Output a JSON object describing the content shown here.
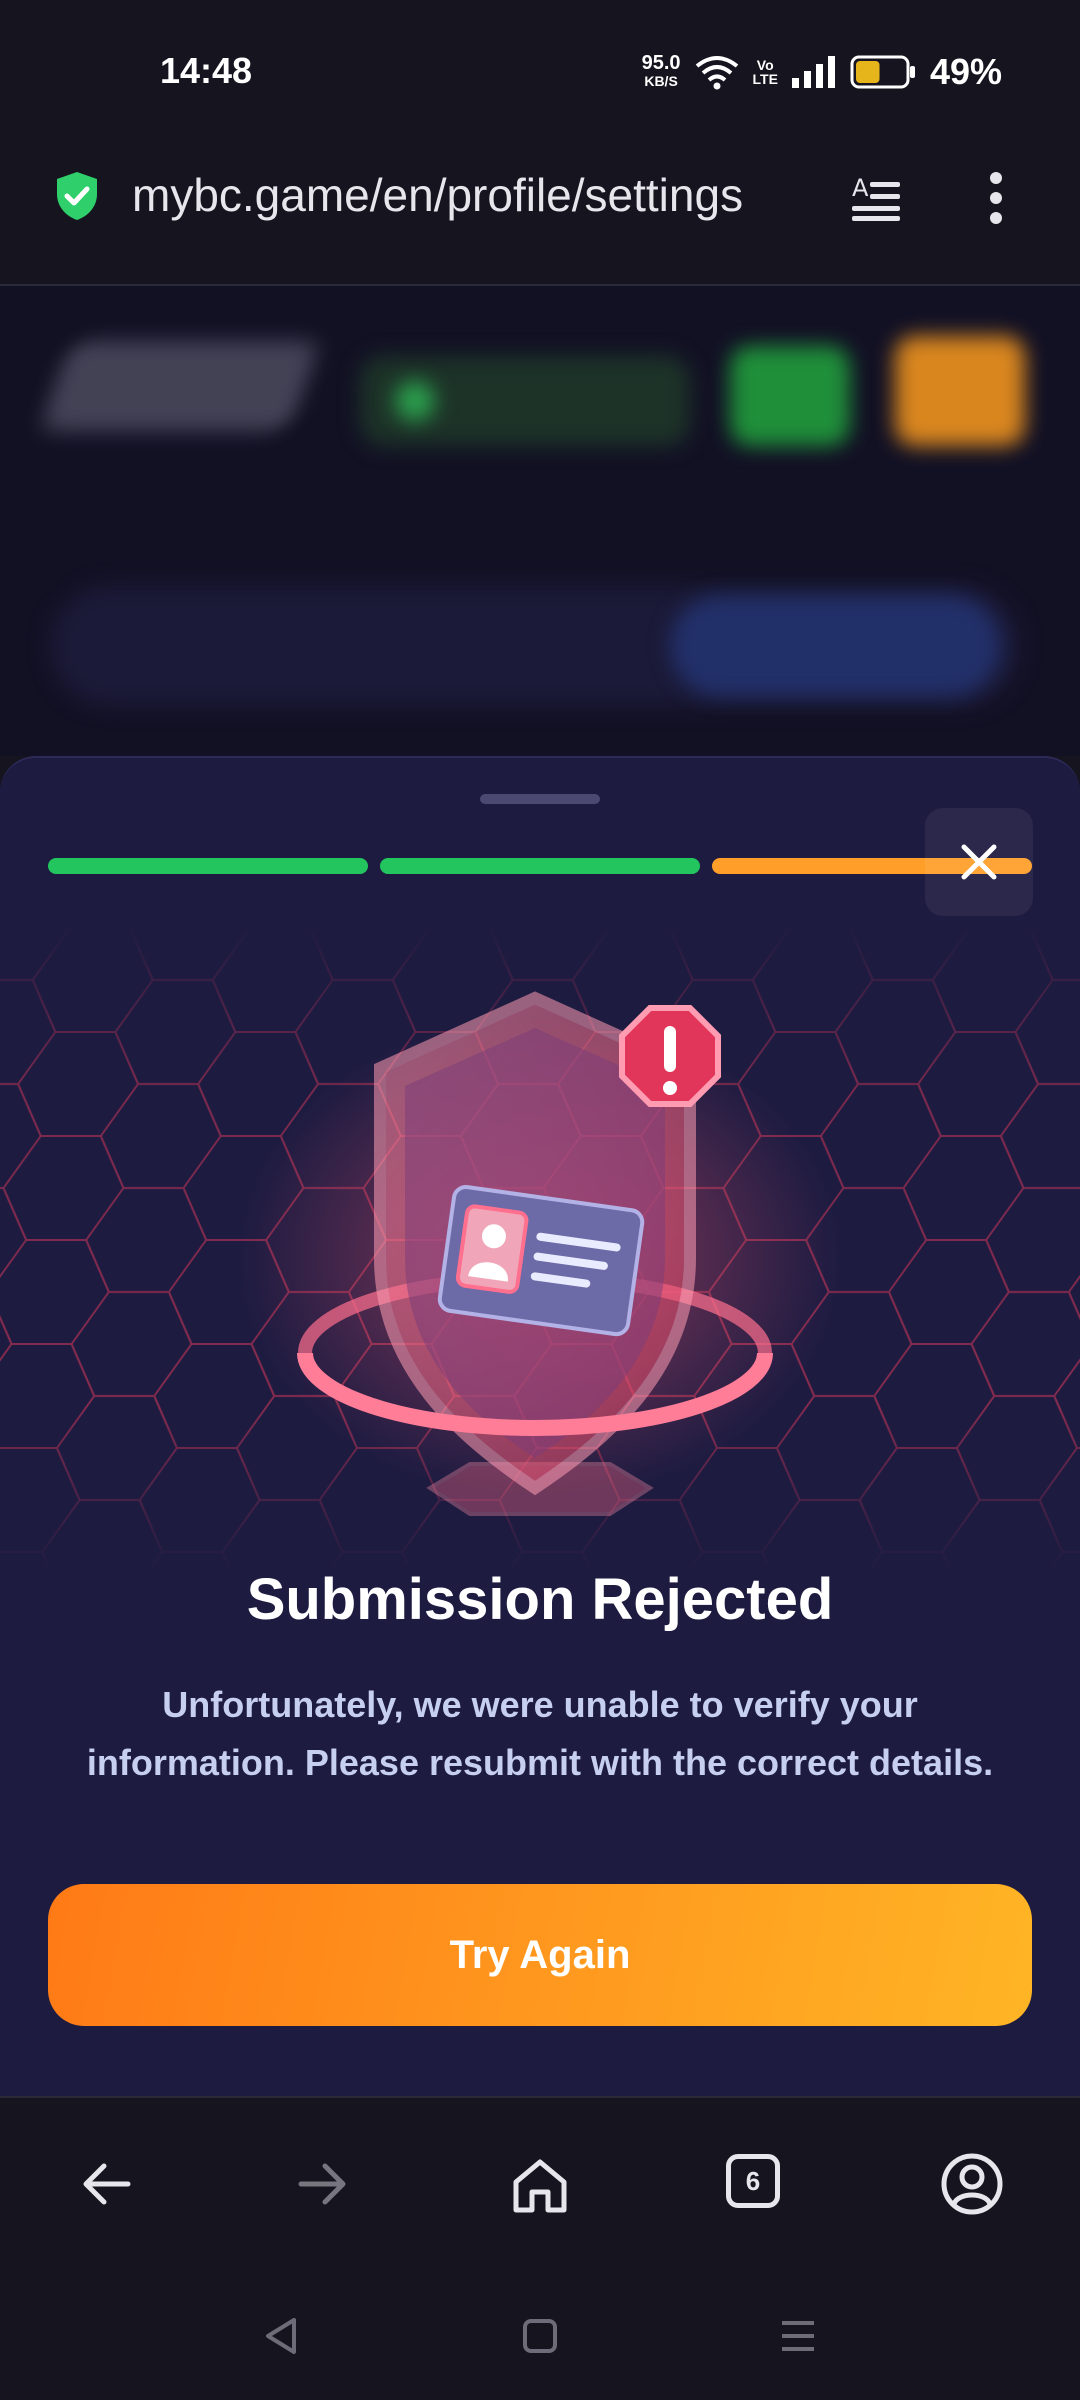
{
  "status_bar": {
    "time": "14:48",
    "net_speed": "95.0",
    "net_unit": "KB/S",
    "volte_top": "Vo",
    "volte_bottom": "LTE",
    "battery": "49%",
    "battery_level": 0.49
  },
  "browser": {
    "url": "mybc.game/en/profile/settings",
    "tab_count": "6",
    "secure_icon": "shield-check-icon",
    "accent": "#2fd06b"
  },
  "modal": {
    "progress_steps": [
      {
        "state": "complete",
        "color": "#22c55e"
      },
      {
        "state": "complete",
        "color": "#22c55e"
      },
      {
        "state": "current",
        "color": "#ff9f2a"
      }
    ],
    "title": "Submission Rejected",
    "description_line1": "Unfortunately, we were unable to verify your",
    "description_line2": "information. Please resubmit with the correct details.",
    "button_label": "Try Again",
    "button_color": "#ff9a1f"
  }
}
